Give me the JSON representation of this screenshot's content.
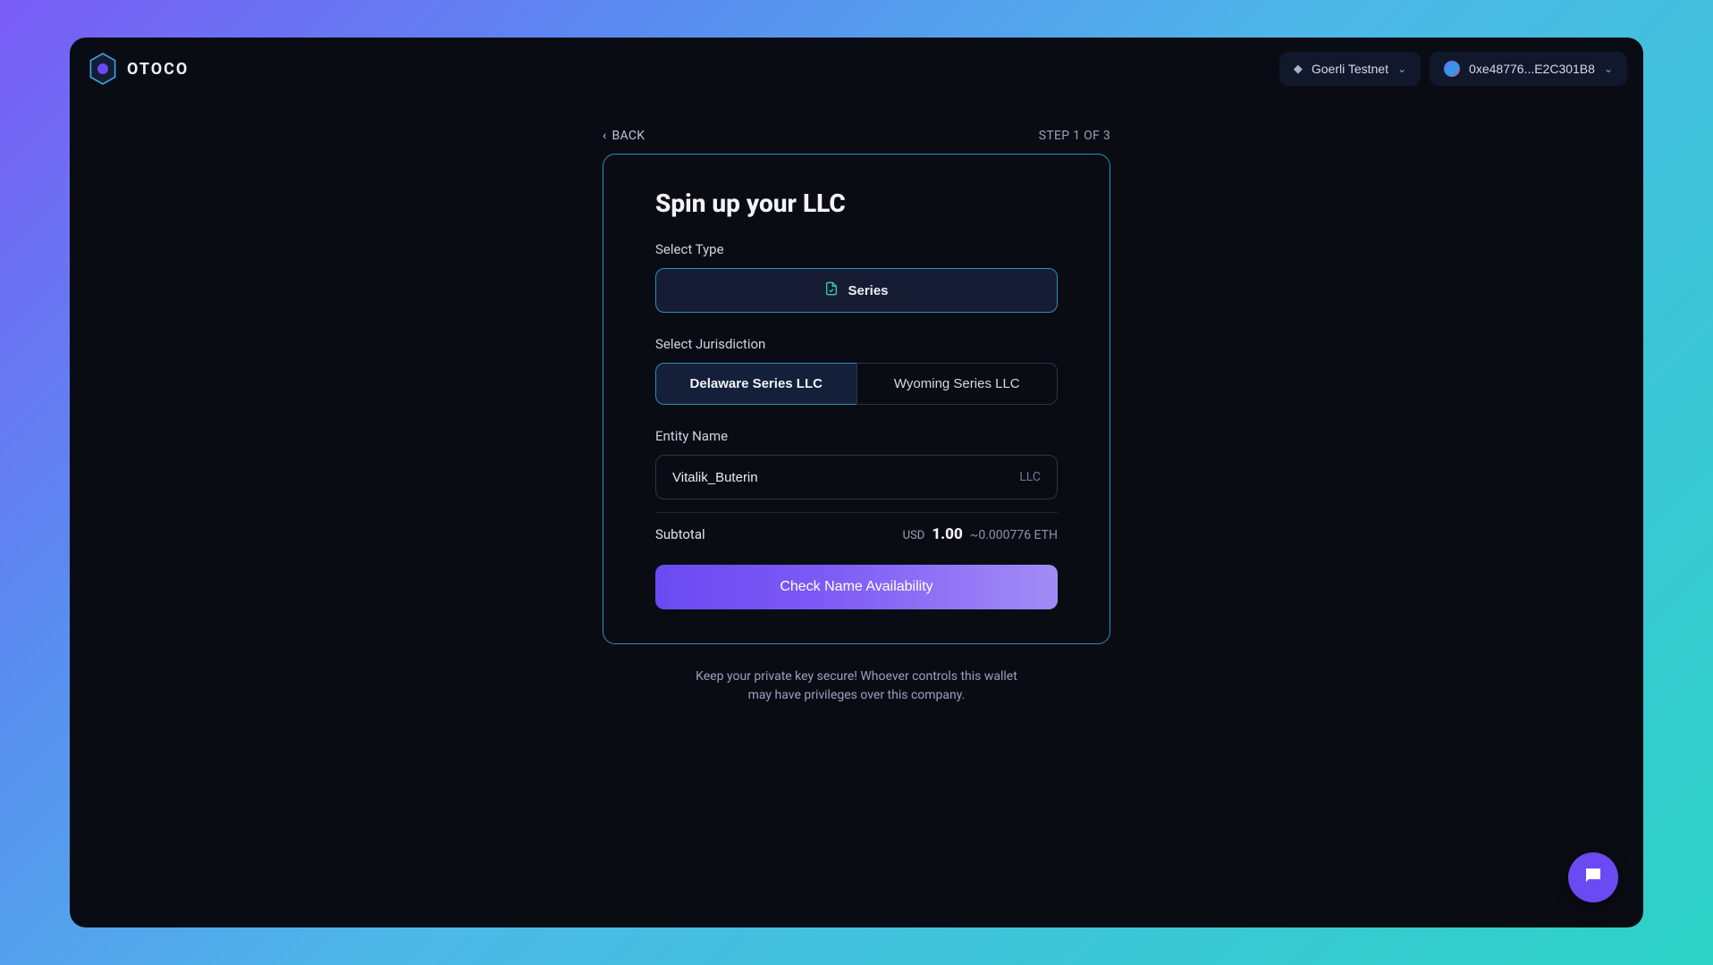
{
  "brand": {
    "name": "OTOCO"
  },
  "header": {
    "network": "Goerli Testnet",
    "wallet": "0xe48776...E2C301B8"
  },
  "meta": {
    "back": "BACK",
    "step": "STEP 1 OF 3"
  },
  "form": {
    "title": "Spin up your LLC",
    "type_label": "Select Type",
    "type_option": "Series",
    "jurisdiction_label": "Select Jurisdiction",
    "jurisdictions": [
      {
        "label": "Delaware Series LLC",
        "active": true
      },
      {
        "label": "Wyoming Series LLC",
        "active": false
      }
    ],
    "entity_label": "Entity Name",
    "entity_value": "Vitalik_Buterin",
    "entity_suffix": "LLC",
    "subtotal_label": "Subtotal",
    "usd_label": "USD",
    "usd_amount": "1.00",
    "eth_approx": "~0.000776 ETH",
    "submit": "Check Name Availability"
  },
  "footnote": "Keep your private key secure! Whoever controls this wallet may have privileges over this company.",
  "colors": {
    "card_border": "#2a8fbf",
    "primary_start": "#6a4af3",
    "primary_end": "#a18cf6"
  }
}
